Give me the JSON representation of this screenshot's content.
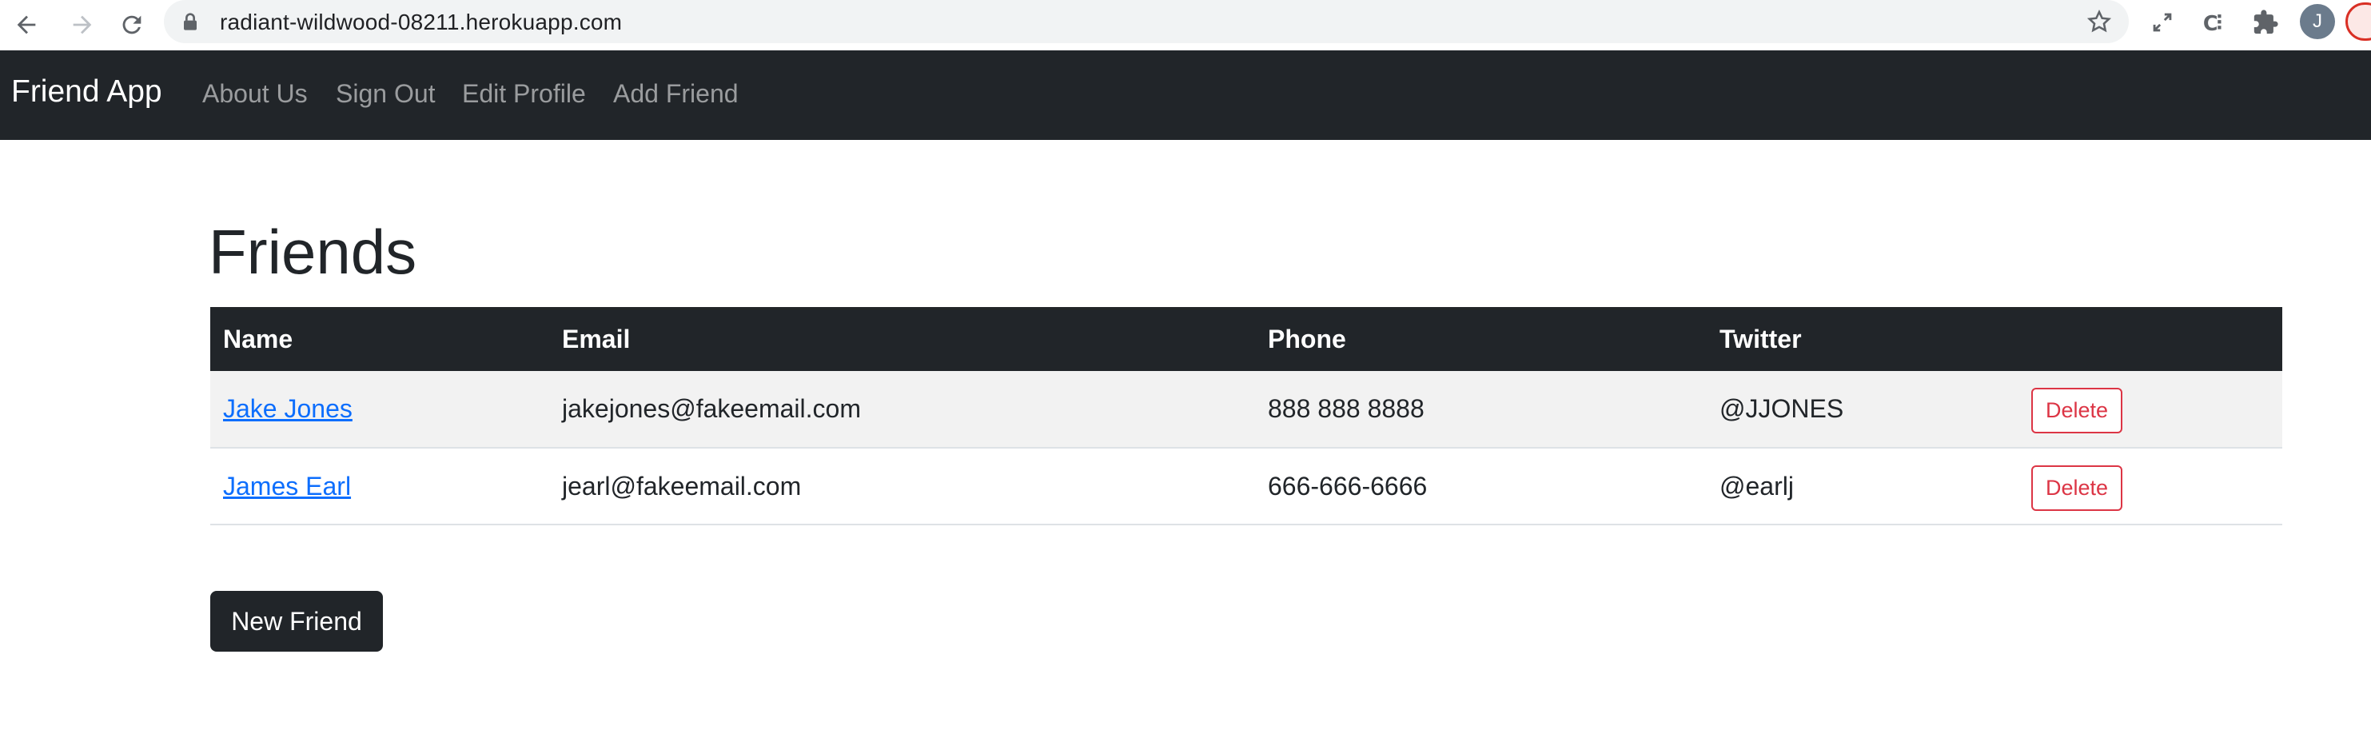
{
  "browser": {
    "url": "radiant-wildwood-08211.herokuapp.com",
    "avatar_letter": "J",
    "icons": [
      "back-icon",
      "forward-icon",
      "reload-icon",
      "lock-icon",
      "star-icon",
      "fullscreen-icon",
      "extension-icon",
      "puzzle-icon"
    ]
  },
  "navbar": {
    "brand": "Friend App",
    "links": [
      "About Us",
      "Sign Out",
      "Edit Profile",
      "Add Friend"
    ]
  },
  "main": {
    "title": "Friends",
    "table": {
      "headers": [
        "Name",
        "Email",
        "Phone",
        "Twitter",
        ""
      ],
      "rows": [
        {
          "name": "Jake Jones",
          "email": "jakejones@fakeemail.com",
          "phone": "888 888 8888",
          "twitter": "@JJONES",
          "action": "Delete"
        },
        {
          "name": "James Earl",
          "email": "jearl@fakeemail.com",
          "phone": "666-666-6666",
          "twitter": "@earlj",
          "action": "Delete"
        }
      ]
    },
    "new_button": "New Friend"
  },
  "colors": {
    "navbar_bg": "#212529",
    "link": "#0d6efd",
    "danger": "#dc3545",
    "stripe": "#f2f2f2"
  }
}
